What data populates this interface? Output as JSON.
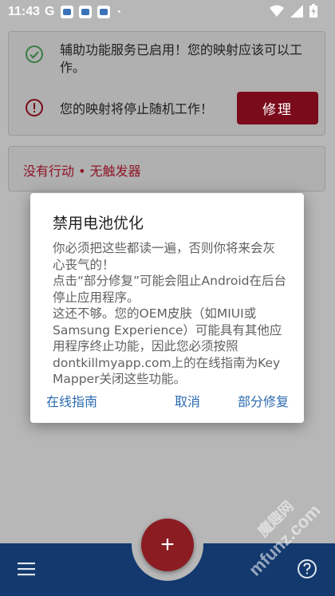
{
  "status_bar": {
    "time": "11:43",
    "carrier_glyph": "G",
    "dot": "•",
    "icons": [
      "notification-app-icon",
      "notification-app-icon",
      "notification-app-icon",
      "wifi-icon",
      "signal-icon",
      "battery-charging-icon"
    ]
  },
  "status_card": {
    "accessibility_text": "辅助功能服务已启用！您的映射应该可以工作。",
    "warning_text": "您的映射将停止随机工作！",
    "fix_label": "修理"
  },
  "mapping_card": {
    "text": "没有行动 • 无触发器"
  },
  "dialog": {
    "title": "禁用电池优化",
    "body": "你必须把这些都读一遍，否则你将来会灰心丧气的！\n点击“部分修复”可能会阻止Android在后台停止应用程序。\n这还不够。您的OEM皮肤（如MIUI或Samsung Experience）可能具有其他应用程序终止功能，因此您必须按照dontkillmyapp.com上的在线指南为Key Mapper关闭这些功能。",
    "btn_guide": "在线指南",
    "btn_cancel": "取消",
    "btn_partial": "部分修复"
  },
  "bottom_bar": {
    "fab_label": "+",
    "icons": [
      "menu-icon",
      "help-icon"
    ]
  },
  "watermark": {
    "text": "mfunz.com",
    "brand": "魔趣网"
  },
  "colors": {
    "accent_red": "#7a0b1a",
    "dialog_button": "#2b6bb0",
    "bottom_bar": "#13396e",
    "success_green": "#3a7d44"
  }
}
